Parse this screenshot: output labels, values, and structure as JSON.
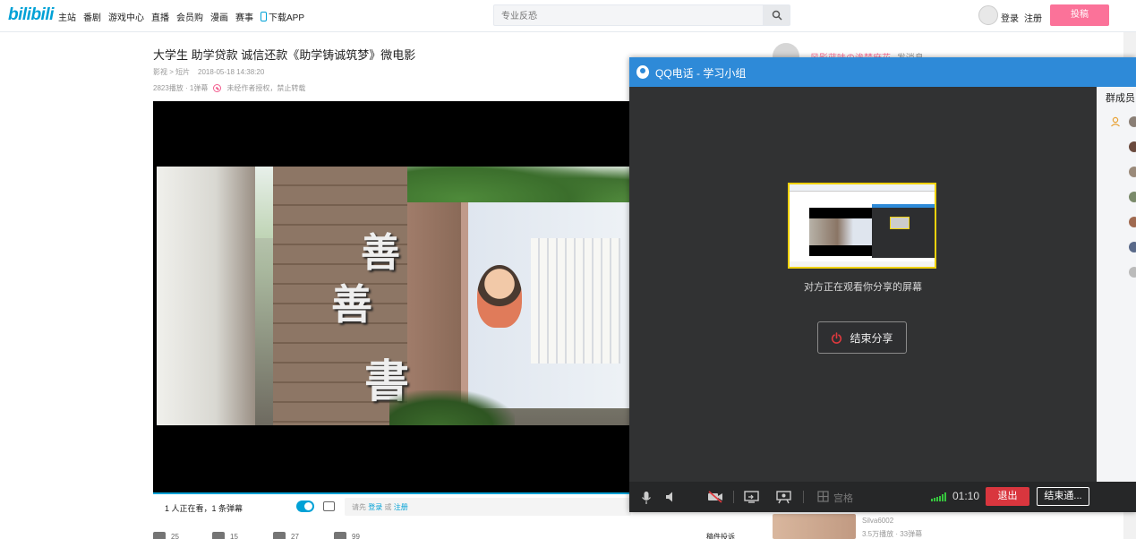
{
  "site": {
    "logo": "bilibili",
    "nav": [
      "主站",
      "番剧",
      "游戏中心",
      "直播",
      "会员购",
      "漫画",
      "赛事",
      "下载APP"
    ],
    "search_placeholder": "专业反恐",
    "login": "登录",
    "register": "注册",
    "upload": "投稿"
  },
  "video": {
    "title": "大学生 助学贷款 诚信还款《助学铸诚筑梦》微电影",
    "category": "影视 > 短片",
    "date": "2018-05-18 14:38:20",
    "stats": "2823播放 · 1弹幕",
    "notice": "未经作者授权，禁止转载",
    "watching": "1 人正在看，1 条弹幕",
    "danmaku_prefix": "请先",
    "danmaku_login": "登录",
    "danmaku_or": "或",
    "danmaku_register": "注册",
    "glyphs": [
      "善",
      "善",
      "書"
    ]
  },
  "actions": {
    "like": "25",
    "coin": "15",
    "star": "27",
    "share": "99",
    "more": "稿件投诉"
  },
  "uploader": {
    "name": "风影蓝味の诶梦麻花",
    "badge": "发消息"
  },
  "recommend": {
    "author": "Silva6002",
    "stats": "3.5万播放 · 33弹幕"
  },
  "qq": {
    "title": "QQ电话 - 学习小组",
    "watch_text": "对方正在观看你分享的屏幕",
    "end_share": "结束分享",
    "grid_label": "宫格",
    "timer": "01:10",
    "exit": "退出",
    "end_call": "结束通...",
    "members_title": "群成员",
    "accent": "#2e8ad8",
    "exit_color": "#d9363e"
  }
}
